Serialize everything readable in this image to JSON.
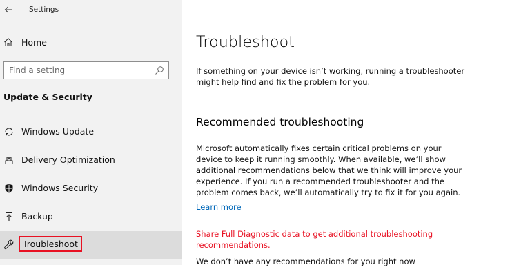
{
  "window": {
    "title": "Settings"
  },
  "sidebar": {
    "home_label": "Home",
    "search_placeholder": "Find a setting",
    "section_title": "Update & Security",
    "items": [
      {
        "label": "Windows Update",
        "icon": "sync-icon"
      },
      {
        "label": "Delivery Optimization",
        "icon": "delivery-optimization-icon"
      },
      {
        "label": "Windows Security",
        "icon": "shield-icon"
      },
      {
        "label": "Backup",
        "icon": "backup-arrow-icon"
      },
      {
        "label": "Troubleshoot",
        "icon": "wrench-icon",
        "selected": true
      }
    ]
  },
  "main": {
    "title": "Troubleshoot",
    "intro": "If something on your device isn’t working, running a troubleshooter might help find and fix the problem for you.",
    "recommended_title": "Recommended troubleshooting",
    "recommended_text": "Microsoft automatically fixes certain critical problems on your device to keep it running smoothly. When available, we’ll show additional recommendations below that we think will improve your experience. If you run a recommended troubleshooter and the problem comes back, we’ll automatically try to fix it for you again.",
    "learn_more": "Learn more",
    "diagnostic_link": "Share Full Diagnostic data to get additional troubleshooting recommendations.",
    "no_recommendations": "We don’t have any recommendations for you right now"
  },
  "colors": {
    "sidebar_bg": "#f2f2f2",
    "selected_bg": "#dcdcdc",
    "highlight_red": "#e81123",
    "link_blue": "#0067b8"
  }
}
